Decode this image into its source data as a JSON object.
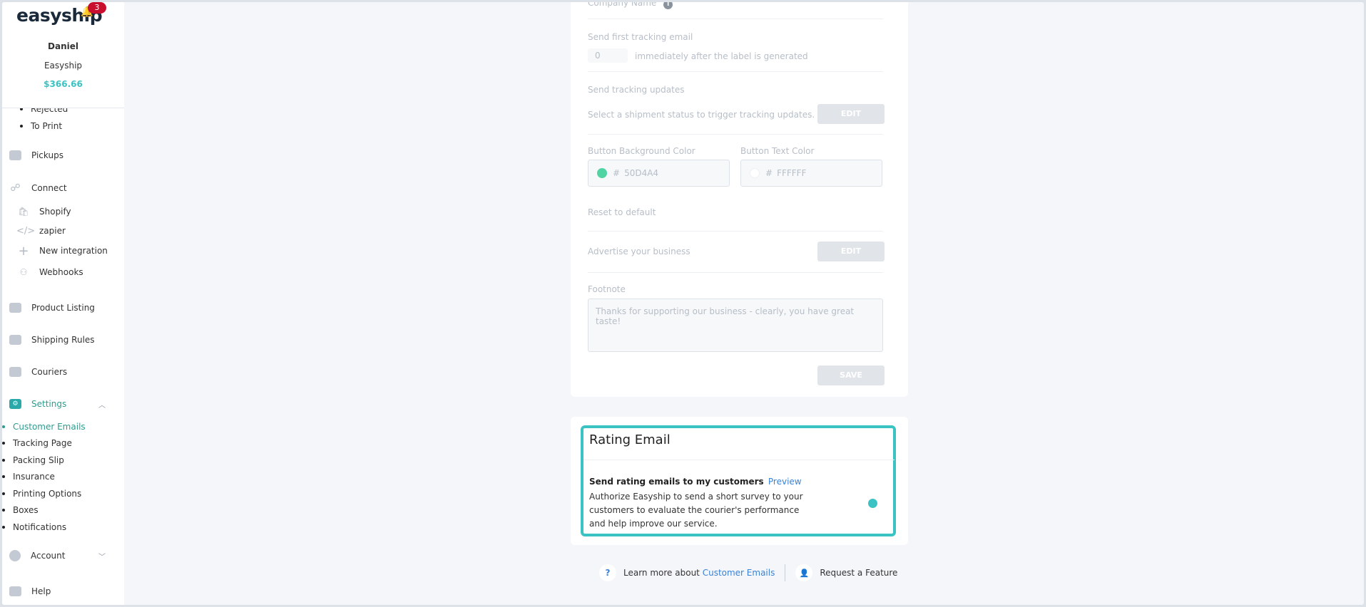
{
  "brand": {
    "logo": "easyship",
    "notifications": "3"
  },
  "user": {
    "name": "Daniel",
    "company": "Easyship",
    "balance": "$366.66"
  },
  "sidebar": {
    "top_sub": [
      "Rejected",
      "To Print"
    ],
    "pickups": "Pickups",
    "connect": "Connect",
    "integrations": [
      "Shopify",
      "zapier",
      "New integration",
      "Webhooks"
    ],
    "product_listing": "Product Listing",
    "shipping_rules": "Shipping Rules",
    "couriers": "Couriers",
    "settings": "Settings",
    "settings_sub": [
      "Customer Emails",
      "Tracking Page",
      "Packing Slip",
      "Insurance",
      "Printing Options",
      "Boxes",
      "Notifications"
    ],
    "account": "Account",
    "help": "Help"
  },
  "tracking_form": {
    "company_name_label": "Company Name",
    "first_email_label": "Send first tracking email",
    "first_email_value": "0",
    "first_email_suffix": "immediately after the label is generated",
    "updates_label": "Send tracking updates",
    "updates_desc": "Select a shipment status to trigger tracking updates.",
    "edit_label": "EDIT",
    "bg_color_label": "Button Background Color",
    "bg_color_hash": "#",
    "bg_color_value": "50D4A4",
    "text_color_label": "Button Text Color",
    "text_color_hash": "#",
    "text_color_value": "FFFFFF",
    "reset_label": "Reset to default",
    "advertise_label": "Advertise your business",
    "footnote_label": "Footnote",
    "footnote_value": "Thanks for supporting our business - clearly, you have great taste!",
    "save_label": "SAVE"
  },
  "rating": {
    "title": "Rating Email",
    "strong": "Send rating emails to my customers",
    "preview": "Preview",
    "desc": "Authorize Easyship to send a short survey to your customers to evaluate the courier's performance and help improve our service.",
    "enabled": true
  },
  "footer": {
    "help_icon": "?",
    "learn_text": "Learn more about",
    "learn_link": "Customer Emails",
    "request": "Request a Feature"
  },
  "colors": {
    "accent": "#3ac3c2",
    "link": "#3a82d6",
    "swatch_bg": "#50D4A4",
    "badge": "#c8102e"
  }
}
